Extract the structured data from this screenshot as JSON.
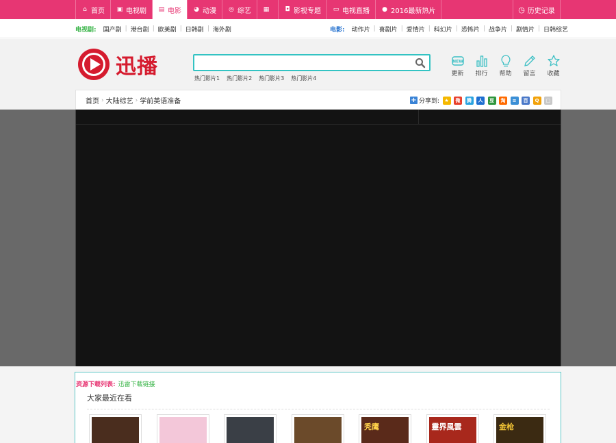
{
  "topnav": {
    "items": [
      {
        "label": "首页",
        "icon": "home-icon",
        "glyph": "⌂"
      },
      {
        "label": "电视剧",
        "icon": "tv-series-icon",
        "glyph": "▣"
      },
      {
        "label": "电影",
        "icon": "film-icon",
        "glyph": "▤",
        "active": true
      },
      {
        "label": "动漫",
        "icon": "anime-icon",
        "glyph": "◕"
      },
      {
        "label": "综艺",
        "icon": "variety-icon",
        "glyph": "◎"
      },
      {
        "label": "",
        "icon": "photo-icon",
        "glyph": "▦"
      },
      {
        "label": "影视专题",
        "icon": "topic-icon",
        "glyph": "◘"
      },
      {
        "label": "电视直播",
        "icon": "monitor-icon",
        "glyph": "▭"
      },
      {
        "label": "2016最新热片",
        "icon": "chat-icon",
        "glyph": "●"
      }
    ],
    "history_label": "历史记录",
    "history_glyph": "◷"
  },
  "categories": {
    "tv": {
      "title": "电视剧:",
      "title_color": "#3bb54a",
      "links": [
        "国产剧",
        "港台剧",
        "欧美剧",
        "日韩剧",
        "海外剧"
      ]
    },
    "movie": {
      "title": "电影:",
      "title_color": "#2f78d1",
      "links": [
        "动作片",
        "喜剧片",
        "爱情片",
        "科幻片",
        "恐怖片",
        "战争片",
        "剧情片",
        "日韩综艺"
      ]
    }
  },
  "header": {
    "logo_text": "迅播",
    "search": {
      "value": "",
      "placeholder": ""
    },
    "hot_links": [
      "热门影片1",
      "热门影片2",
      "热门影片3",
      "热门影片4"
    ],
    "tools": [
      {
        "label": "更新",
        "icon": "new-update-icon"
      },
      {
        "label": "排行",
        "icon": "ranking-icon"
      },
      {
        "label": "帮助",
        "icon": "help-bulb-icon"
      },
      {
        "label": "留言",
        "icon": "message-pencil-icon"
      },
      {
        "label": "收藏",
        "icon": "favorite-star-icon"
      }
    ]
  },
  "breadcrumb": {
    "items": [
      "首页",
      "大陆综艺",
      "学前英语准备"
    ],
    "share_label": "分享到:",
    "share_icons": [
      {
        "name": "qzone-share-icon",
        "color": "#f5b800",
        "glyph": "★"
      },
      {
        "name": "weibo-share-icon",
        "color": "#e8402c",
        "glyph": "微"
      },
      {
        "name": "tencent-weibo-share-icon",
        "color": "#2aa3e0",
        "glyph": "腾"
      },
      {
        "name": "renren-share-icon",
        "color": "#1e6fd1",
        "glyph": "人"
      },
      {
        "name": "douban-share-icon",
        "color": "#2e963d",
        "glyph": "豆"
      },
      {
        "name": "taobao-share-icon",
        "color": "#ff6a00",
        "glyph": "淘"
      },
      {
        "name": "email-share-icon",
        "color": "#3b8fd6",
        "glyph": "≡"
      },
      {
        "name": "baidu-share-icon",
        "color": "#4a78c8",
        "glyph": "百"
      },
      {
        "name": "qq-share-icon",
        "color": "#f2a20a",
        "glyph": "Q"
      },
      {
        "name": "copy-share-icon",
        "color": "#c8c8c8",
        "glyph": "□"
      }
    ]
  },
  "downloads": {
    "label": "资源下载列表:",
    "link": "迅雷下载链接",
    "recent_title": "大家最近在看",
    "thumbs": [
      {
        "name": "movie-thumb-1",
        "bg": "#4a2d1e",
        "text": "",
        "color": "#f4d9a0"
      },
      {
        "name": "movie-thumb-2",
        "bg": "#f3c7d9",
        "text": "",
        "color": "#5a8ed6"
      },
      {
        "name": "movie-thumb-3",
        "bg": "#3a3f46",
        "text": "",
        "color": "#d9d9d9"
      },
      {
        "name": "movie-thumb-4",
        "bg": "#6b4a2a",
        "text": "",
        "color": "#f5e1b5"
      },
      {
        "name": "movie-thumb-5",
        "bg": "#5a2a1a",
        "text": "秃鹰",
        "color": "#ffd24a"
      },
      {
        "name": "movie-thumb-6",
        "bg": "#a8281c",
        "text": "靈界風雲",
        "color": "#ffffff"
      },
      {
        "name": "movie-thumb-7",
        "bg": "#3b2a12",
        "text": "金枪",
        "color": "#f0c235"
      }
    ]
  }
}
